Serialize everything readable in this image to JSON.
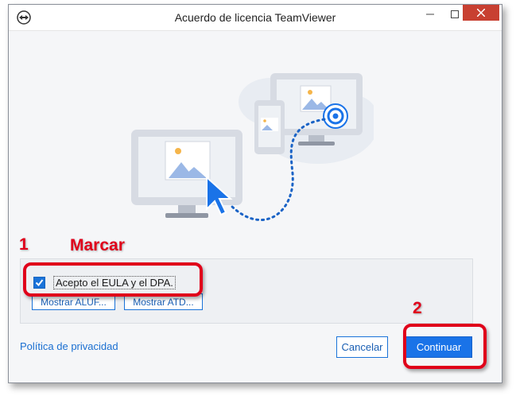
{
  "window": {
    "title": "Acuerdo de licencia TeamViewer",
    "controls": {
      "minimize": "minimize-icon",
      "maximize": "maximize-icon",
      "close": "close-icon"
    }
  },
  "illustration": {
    "description_icons": [
      "monitor-icon",
      "phone-icon",
      "target-icon",
      "cursor-icon",
      "cloud-icon"
    ]
  },
  "consent": {
    "checkbox_label": "Acepto el EULA y el DPA.",
    "checked": true
  },
  "buttons": {
    "show_aluf": "Mostrar ALUF...",
    "show_atd": "Mostrar ATD...",
    "cancel": "Cancelar",
    "continue": "Continuar"
  },
  "links": {
    "privacy": "Política de privacidad"
  },
  "annotations": {
    "step1_number": "1",
    "step1_text": "Marcar",
    "step2_number": "2"
  },
  "colors": {
    "accent": "#1a73e8",
    "annotation": "#e0001a",
    "close_button": "#c84031"
  }
}
